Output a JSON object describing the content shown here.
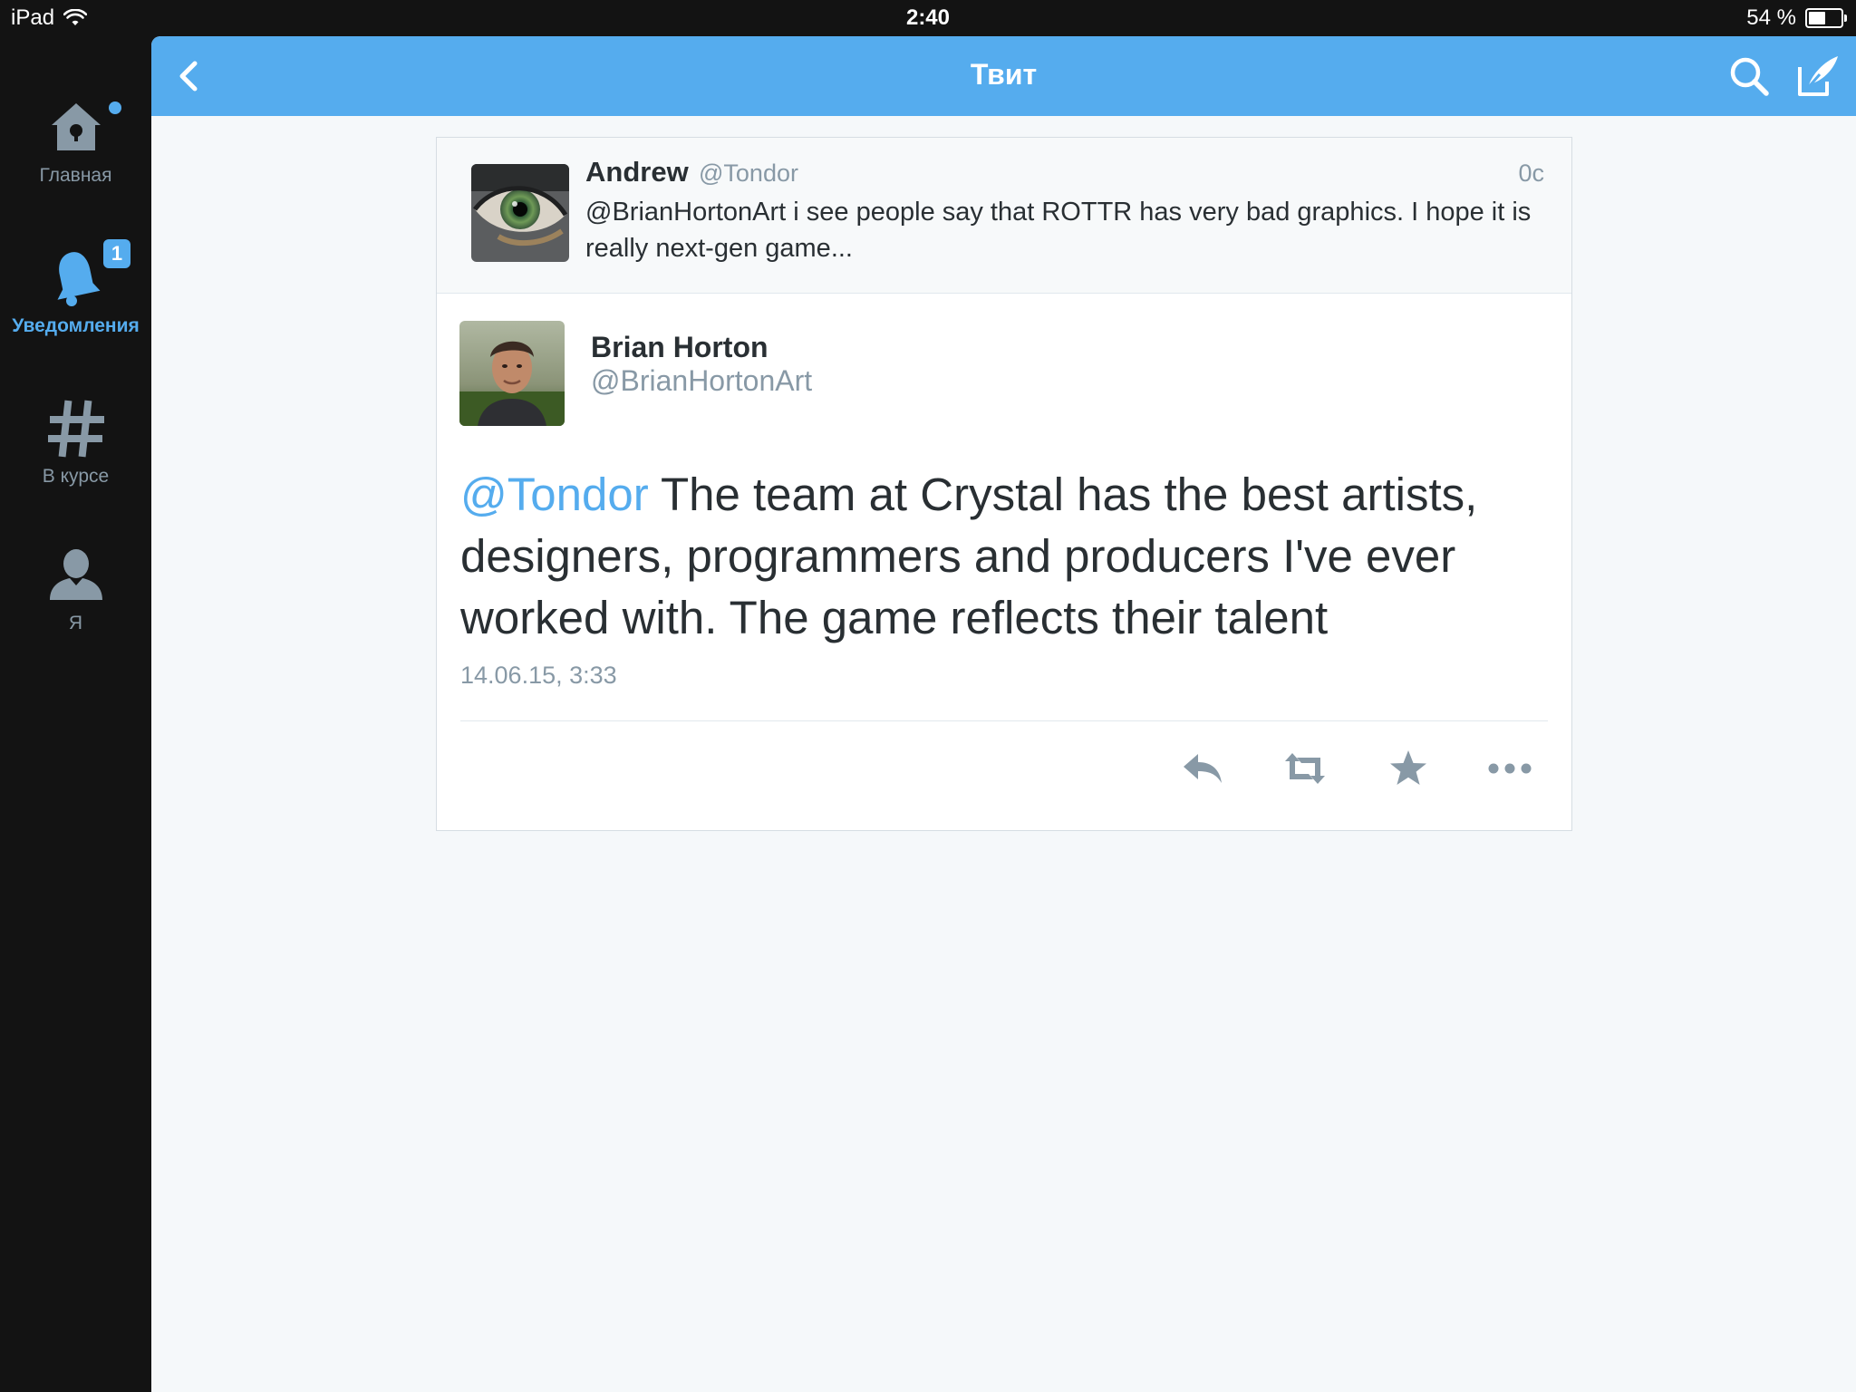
{
  "status_bar": {
    "device": "iPad",
    "time": "2:40",
    "battery": "54 %"
  },
  "sidebar": {
    "items": [
      {
        "label": "Главная",
        "icon": "home-icon"
      },
      {
        "label": "Уведомления",
        "icon": "bell-icon",
        "badge": "1"
      },
      {
        "label": "В курсе",
        "icon": "hashtag-icon"
      },
      {
        "label": "Я",
        "icon": "profile-icon"
      }
    ]
  },
  "nav": {
    "title": "Твит"
  },
  "parent_tweet": {
    "name": "Andrew",
    "handle": "@Tondor",
    "time": "0с",
    "text": "@BrianHortonArt i see people say that ROTTR has very bad graphics. I hope it is really next-gen game..."
  },
  "tweet": {
    "name": "Brian Horton",
    "handle": "@BrianHortonArt",
    "mention": "@Tondor",
    "text": " The team at Crystal has the best artists, designers, programmers and producers I've ever worked with. The game reflects their talent",
    "date": "14.06.15, 3:33"
  },
  "colors": {
    "accent": "#55acee",
    "sidebar_bg": "#131313",
    "content_bg": "#f5f8fa",
    "secondary_text": "#8899a6"
  }
}
